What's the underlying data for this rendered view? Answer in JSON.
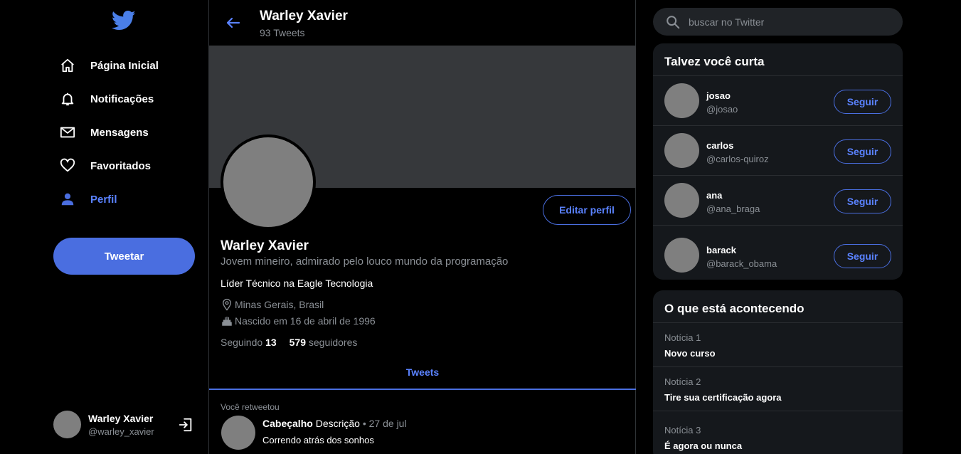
{
  "colors": {
    "accent": "#4a6ee0",
    "accent_text": "#5a82ff",
    "background": "#000000",
    "card": "#15181c",
    "muted": "#8a8f95"
  },
  "sidebar": {
    "logo_icon": "twitter-bird-icon",
    "nav": [
      {
        "label": "Página Inicial",
        "icon": "home-icon"
      },
      {
        "label": "Notificações",
        "icon": "bell-icon"
      },
      {
        "label": "Mensagens",
        "icon": "mail-icon"
      },
      {
        "label": "Favoritados",
        "icon": "heart-icon"
      },
      {
        "label": "Perfil",
        "icon": "user-icon",
        "active": true
      }
    ],
    "tweet_button": "Tweetar",
    "user": {
      "name": "Warley Xavier",
      "handle": "@warley_xavier"
    },
    "logout_icon": "logout-icon"
  },
  "header": {
    "name": "Warley Xavier",
    "tweet_count": "93 Tweets"
  },
  "profile": {
    "name": "Warley Xavier",
    "bio": "Jovem mineiro, admirado pelo louco mundo da programação",
    "role": "Líder Técnico na Eagle Tecnologia",
    "location": "Minas Gerais, Brasil",
    "birth": "Nascido em 16 de abril de 1996",
    "following_label": "Seguindo",
    "following_count": "13",
    "followers_count": "579",
    "followers_label": "seguidores",
    "edit_button": "Editar perfil"
  },
  "tabs": {
    "tweets": "Tweets"
  },
  "timeline": {
    "retweet_note": "Você retweetou",
    "tweet": {
      "header": "Cabeçalho",
      "description": "Descrição",
      "separator": "•",
      "date": "27 de jul",
      "text": "Correndo atrás dos sonhos"
    }
  },
  "search": {
    "placeholder": "buscar no Twitter"
  },
  "suggestions": {
    "title": "Talvez você curta",
    "follow_label": "Seguir",
    "users": [
      {
        "name": "josao",
        "handle": "@josao"
      },
      {
        "name": "carlos",
        "handle": "@carlos-quiroz"
      },
      {
        "name": "ana",
        "handle": "@ana_braga"
      },
      {
        "name": "barack",
        "handle": "@barack_obama"
      }
    ]
  },
  "trends": {
    "title": "O que está acontecendo",
    "items": [
      {
        "label": "Notícia 1",
        "title": "Novo curso"
      },
      {
        "label": "Notícia 2",
        "title": "Tire sua certificação agora"
      },
      {
        "label": "Notícia 3",
        "title": "É agora ou nunca"
      }
    ]
  }
}
